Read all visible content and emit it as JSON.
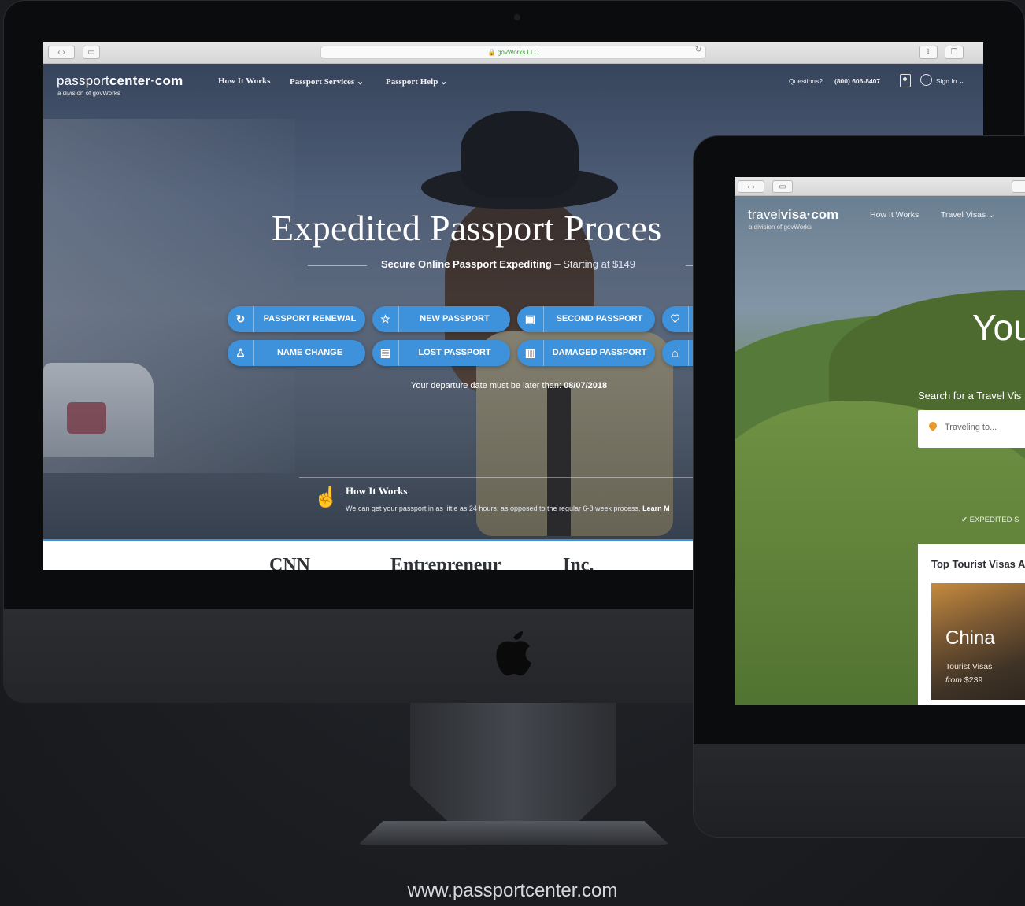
{
  "imac_browser": {
    "address": "govWorks LLC",
    "nav": {
      "logo_light": "passport",
      "logo_bold": "center·com",
      "logo_sub": "a division of govWorks",
      "items": [
        {
          "label": "How It Works"
        },
        {
          "label": "Passport Services ⌄"
        },
        {
          "label": "Passport Help ⌄"
        }
      ],
      "questions_label": "Questions?",
      "phone": "(800) 606-8407",
      "sign_in": "Sign In ⌄"
    },
    "hero": {
      "headline": "Expedited Passport Proces",
      "subline_bold": "Secure Online Passport Expediting",
      "subline_light": " – Starting at $149",
      "buttons": [
        {
          "label": "PASSPORT RENEWAL",
          "icon": "↻"
        },
        {
          "label": "NEW PASSPORT",
          "icon": "☆"
        },
        {
          "label": "SECOND PASSPORT",
          "icon": "▣"
        },
        {
          "label": "NAME CHANGE",
          "icon": "♙"
        },
        {
          "label": "LOST PASSPORT",
          "icon": "▤"
        },
        {
          "label": "DAMAGED PASSPORT",
          "icon": "▥"
        }
      ],
      "departure_prefix": "Your departure date must be later than: ",
      "departure_date": "08/07/2018",
      "how_it_works_title": "How It Works",
      "how_it_works_text": "We can get your passport in as little as 24 hours, as opposed to the regular 6-8 week process.",
      "how_it_works_link": "Learn M"
    },
    "press": [
      "CNN",
      "Entrepreneur",
      "Inc."
    ]
  },
  "ipad_browser": {
    "nav": {
      "logo_light": "travel",
      "logo_bold": "visa·com",
      "logo_sub": "a division of govWorks",
      "items": [
        {
          "label": "How It Works"
        },
        {
          "label": "Travel Visas ⌄"
        }
      ]
    },
    "hero": {
      "headline": "You",
      "search_label": "Search for a Travel Vis",
      "search_placeholder": "Traveling to...",
      "expedited": "EXPEDITED S"
    },
    "card": {
      "title": "Top Tourist Visas A",
      "country": "China",
      "visa_type": "Tourist Visas",
      "from_label": "from",
      "price": "$239"
    }
  },
  "caption": "www.passportcenter.com",
  "colors": {
    "accent": "#3d92db",
    "background": "#1c1e22"
  }
}
